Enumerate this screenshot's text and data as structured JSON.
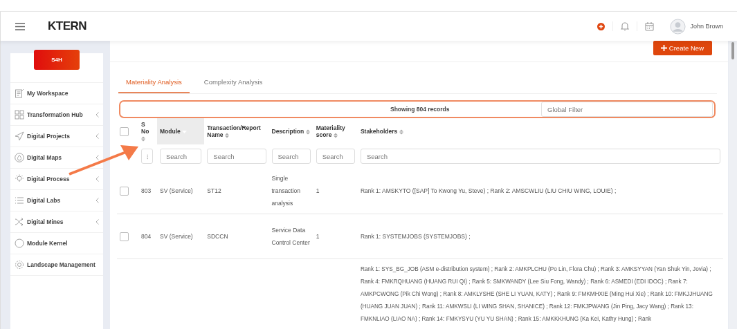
{
  "header": {
    "logo": "KTERN",
    "user": "John Brown"
  },
  "sidebar": {
    "badge": "S4H",
    "items": [
      {
        "label": "My Workspace",
        "has_submenu": false
      },
      {
        "label": "Transformation Hub",
        "has_submenu": true
      },
      {
        "label": "Digital Projects",
        "has_submenu": true
      },
      {
        "label": "Digital Maps",
        "has_submenu": true
      },
      {
        "label": "Digital Process",
        "has_submenu": true
      },
      {
        "label": "Digital Labs",
        "has_submenu": true
      },
      {
        "label": "Digital Mines",
        "has_submenu": true
      },
      {
        "label": "Module Kernel",
        "has_submenu": false
      },
      {
        "label": "Landscape Management",
        "has_submenu": false
      }
    ]
  },
  "create_button": "Create New",
  "tabs": [
    {
      "label": "Materiality Analysis",
      "selected": true
    },
    {
      "label": "Complexity Analysis",
      "selected": false
    }
  ],
  "records_info": "Showing 804 records",
  "global_filter": {
    "placeholder": "Global Filter"
  },
  "table": {
    "select_all_checked": false,
    "columns": [
      {
        "label": "S No",
        "sorted": false,
        "menu_button": "⁝"
      },
      {
        "label": "Module",
        "sorted": true,
        "placeholder": "Search"
      },
      {
        "label": "Transaction/Report Name",
        "sorted": false,
        "placeholder": "Search"
      },
      {
        "label": "Description",
        "sorted": false,
        "placeholder": "Search"
      },
      {
        "label": "Materiality score",
        "sorted": false,
        "placeholder": "Search"
      },
      {
        "label": "Stakeholders",
        "sorted": false,
        "placeholder": "Search"
      }
    ],
    "rows": [
      {
        "checked": false,
        "cells": [
          "803",
          "SV (Service)",
          "ST12",
          "Single transaction analysis",
          "1",
          "Rank 1: AMSKYTO ([SAP] To Kwong Yu, Steve) ; Rank 2: AMSCWLIU (LIU CHIU WING, LOUIE) ;"
        ]
      },
      {
        "checked": false,
        "cells": [
          "804",
          "SV (Service)",
          "SDCCN",
          "Service Data Control Center",
          "1",
          "Rank 1: SYSTEMJOBS (SYSTEMJOBS) ;"
        ]
      },
      {
        "cells": [
          "",
          "",
          "",
          "",
          "",
          "Rank 1: SYS_BG_JOB (ASM e-distribution system) ; Rank 2: AMKPLCHU (Po Lin, Flora Chu) ; Rank 3: AMKSYYAN (Yan Shuk Yin, Jovia) ; Rank 4: FMKRQHUANG (HUANG RUI QI) ; Rank 5: SMKWANDY (Lee Siu Fong, Wandy) ; Rank 6: ASMEDI (EDI IDOC) ; Rank 7: AMKPCWONG (Pik Chi Wong) ; Rank 8: AMKLYSHE (SHE LI YUAN, KATY) ; Rank 9: FMKMHXIE (Ming Hui Xie) ; Rank 10: FMKJJHUANG (HUANG JUAN JUAN) ; Rank 11: AMKWSLI (LI WING SHAN, SHANICE) ; Rank 12: FMKJPWANG (Jin Ping, Jacy Wang) ; Rank 13: FMKNLIAO (LIAO NA) ; Rank 14: FMKYSYU (YU YU SHAN) ; Rank 15: AMKKKHUNG (Ka Kei, Kathy Hung) ; Rank"
        ]
      }
    ]
  }
}
